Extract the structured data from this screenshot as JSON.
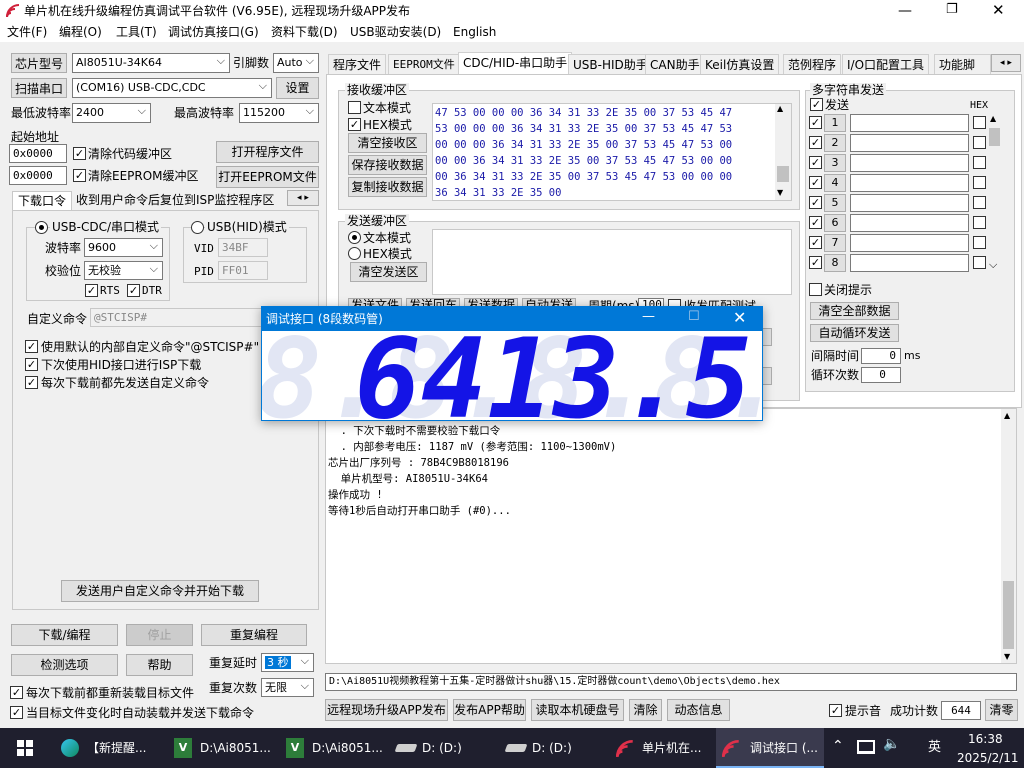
{
  "window": {
    "title": "单片机在线升级编程仿真调试平台软件 (V6.95E), 远程现场升级APP发布"
  },
  "menu": [
    "文件(F)",
    "编程(O)",
    "工具(T)",
    "调试仿真接口(G)",
    "资料下载(D)",
    "USB驱动安装(D)",
    "English"
  ],
  "left": {
    "chip_label": "芯片型号",
    "chip_value": "AI8051U-34K64",
    "pins_label": "引脚数",
    "pins_value": "Auto",
    "scan_label": "扫描串口",
    "port_value": "(COM16) USB-CDC,CDC",
    "settings_label": "设置",
    "min_baud_label": "最低波特率",
    "min_baud_value": "2400",
    "max_baud_label": "最高波特率",
    "max_baud_value": "115200",
    "start_addr_label": "起始地址",
    "addr1": "0x0000",
    "clear_code": "清除代码缓冲区",
    "open_prog": "打开程序文件",
    "addr2": "0x0000",
    "clear_eeprom": "清除EEPROM缓冲区",
    "open_eeprom": "打开EEPROM文件",
    "subtabs": [
      "下载口令",
      "收到用户命令后复位到ISP监控程序区"
    ],
    "usb_cdc_mode": "USB-CDC/串口模式",
    "usb_hid_mode": "USB(HID)模式",
    "baud_label": "波特率",
    "baud_value": "9600",
    "parity_label": "校验位",
    "parity_value": "无校验",
    "vid_label": "VID",
    "vid_value": "34BF",
    "pid_label": "PID",
    "pid_value": "FF01",
    "rts": "RTS",
    "dtr": "DTR",
    "custom_cmd_label": "自定义命令",
    "custom_cmd_value": "@STCISP#",
    "opt1": "使用默认的内部自定义命令\"@STCISP#\"",
    "opt2": "下次使用HID接口进行ISP下载",
    "opt3": "每次下载前都先发送自定义命令",
    "send_custom": "发送用户自定义命令并开始下载",
    "download": "下载/编程",
    "stop": "停止",
    "reprogram": "重复编程",
    "check": "检测选项",
    "help": "帮助",
    "delay_label": "重复延时",
    "delay_value": "3 秒",
    "times_label": "重复次数",
    "times_value": "无限",
    "reload_each": "每次下载前都重新装载目标文件",
    "auto_reload": "当目标文件变化时自动装载并发送下载命令"
  },
  "tabs": [
    "程序文件",
    "EEPROM文件",
    "CDC/HID-串口助手",
    "USB-HID助手",
    "CAN助手",
    "Keil仿真设置",
    "范例程序",
    "I/O口配置工具",
    "功能脚"
  ],
  "recv": {
    "title": "接收缓冲区",
    "text_mode": "文本模式",
    "hex_mode": "HEX模式",
    "clear": "清空接收区",
    "save": "保存接收数据",
    "copy": "复制接收数据",
    "lines": [
      "47 53 00 00 00 36 34 31 33 2E 35 00 37 53 45 47",
      "53 00 00 00 36 34 31 33 2E 35 00 37 53 45 47 53",
      "00 00 00 36 34 31 33 2E 35 00 37 53 45 47 53 00",
      "00 00 36 34 31 33 2E 35 00 37 53 45 47 53 00 00",
      "00 36 34 31 33 2E 35 00 37 53 45 47 53 00 00 00",
      "36 34 31 33 2E 35 00"
    ]
  },
  "send": {
    "title": "发送缓冲区",
    "text_mode": "文本模式",
    "hex_mode": "HEX模式",
    "clear": "清空发送区",
    "row": [
      "发送文件",
      "发送回车",
      "发送数据",
      "自动发送",
      "周期(ms)",
      "100",
      "收发匹配测试"
    ]
  },
  "multi": {
    "title": "多字符串发送",
    "send": "发送",
    "hex": "HEX",
    "rows": [
      "1",
      "2",
      "3",
      "4",
      "5",
      "6",
      "7",
      "8"
    ],
    "close_hint": "关闭提示",
    "clear_all": "清空全部数据",
    "auto_loop": "自动循环发送",
    "interval_label": "间隔时间",
    "interval_value": "0",
    "interval_unit": "ms",
    "loop_label": "循环次数",
    "loop_value": "0"
  },
  "dialog": {
    "title": "调试接口 (8段数码管)",
    "ghost": "8.8.8.8.",
    "value": "6413.5",
    "digit_color": "#1414e6",
    "ghost_color": "#e2e6f4"
  },
  "log": [
    "  . 下次下载时不需要校验下载口令",
    "  . 内部参考电压: 1187 mV (参考范围: 1100~1300mV)",
    "芯片出厂序列号 : 78B4C9B8018196",
    "",
    "  单片机型号: AI8051U-34K64",
    "",
    "操作成功 !",
    "",
    "等待1秒后自动打开串口助手 (#0)..."
  ],
  "path": "D:\\Ai8051U视频教程第十五集-定时器做计shu器\\15.定时器做count\\demo\\Objects\\demo.hex",
  "bottom": {
    "remote": "远程现场升级APP发布",
    "publish": "发布APP帮助",
    "read_disk": "读取本机硬盘号",
    "clear": "清除",
    "anim": "动态信息",
    "sound": "提示音",
    "count_label": "成功计数",
    "count_value": "644",
    "clear2": "清零"
  },
  "taskbar": {
    "items": [
      "【新提醒...",
      "D:\\Ai8051...",
      "D:\\Ai8051...",
      "D: (D:)",
      "D: (D:)",
      "单片机在...",
      "调试接口 (..."
    ],
    "lang": "英",
    "time": "16:38",
    "date": "2025/2/11"
  }
}
